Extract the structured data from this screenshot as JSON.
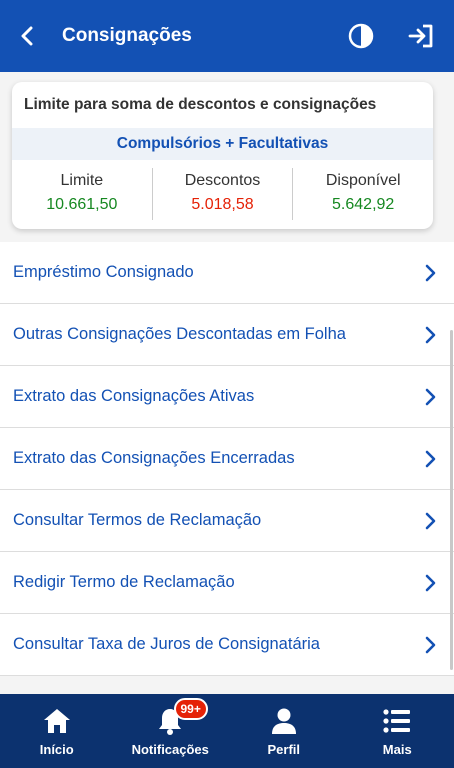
{
  "header": {
    "title": "Consignações",
    "back_icon": "chevron-left-icon",
    "contrast_icon": "contrast-icon",
    "logout_icon": "logout-icon"
  },
  "summary": {
    "title": "Limite para soma de descontos e consignações",
    "subtitle": "Compulsórios + Facultativas",
    "columns": [
      {
        "label": "Limite",
        "value": "10.661,50",
        "color": "#168821"
      },
      {
        "label": "Descontos",
        "value": "5.018,58",
        "color": "#e52207"
      },
      {
        "label": "Disponível",
        "value": "5.642,92",
        "color": "#168821"
      }
    ]
  },
  "menu": {
    "items": [
      {
        "label": "Empréstimo Consignado"
      },
      {
        "label": "Outras Consignações Descontadas em Folha"
      },
      {
        "label": "Extrato das Consignações Ativas"
      },
      {
        "label": "Extrato das Consignações Encerradas"
      },
      {
        "label": "Consultar Termos de Reclamação"
      },
      {
        "label": "Redigir Termo de Reclamação"
      },
      {
        "label": "Consultar Taxa de Juros de Consignatária"
      }
    ]
  },
  "bottom_nav": {
    "items": [
      {
        "label": "Início",
        "icon": "home-icon"
      },
      {
        "label": "Notificações",
        "icon": "bell-icon",
        "badge": "99+"
      },
      {
        "label": "Perfil",
        "icon": "user-icon"
      },
      {
        "label": "Mais",
        "icon": "menu-icon"
      }
    ]
  },
  "colors": {
    "primary": "#1351b4",
    "nav_bg": "#0c326f",
    "positive": "#168821",
    "negative": "#e52207"
  }
}
